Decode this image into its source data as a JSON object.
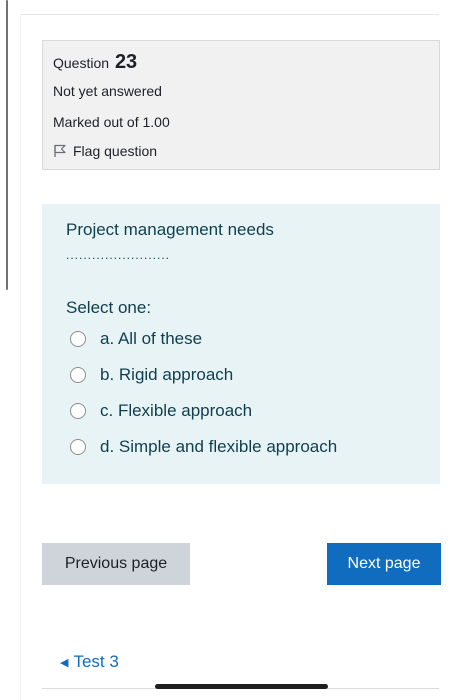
{
  "question_info": {
    "question_prefix": "Question",
    "question_number": "23",
    "state": "Not yet answered",
    "grade": "Marked out of 1.00",
    "flag_label": "Flag question"
  },
  "question": {
    "text": "Project management needs",
    "blank": "........................",
    "prompt": "Select one:",
    "options": [
      {
        "label": "a. All of these"
      },
      {
        "label": "b. Rigid approach"
      },
      {
        "label": "c. Flexible approach"
      },
      {
        "label": "d. Simple and flexible approach"
      }
    ]
  },
  "navigation": {
    "previous_label": "Previous page",
    "next_label": "Next page",
    "back_link_label": "Test 3"
  },
  "colors": {
    "info_bg": "#f1f1f2",
    "content_bg": "#e7f3f5",
    "primary": "#0f6cbf",
    "secondary_btn": "#ced4da",
    "question_text": "#0f3f4e"
  },
  "icons": {
    "flag": "flag-outline-icon",
    "back_arrow": "triangle-left-icon",
    "radio": "radio-unchecked-icon"
  }
}
